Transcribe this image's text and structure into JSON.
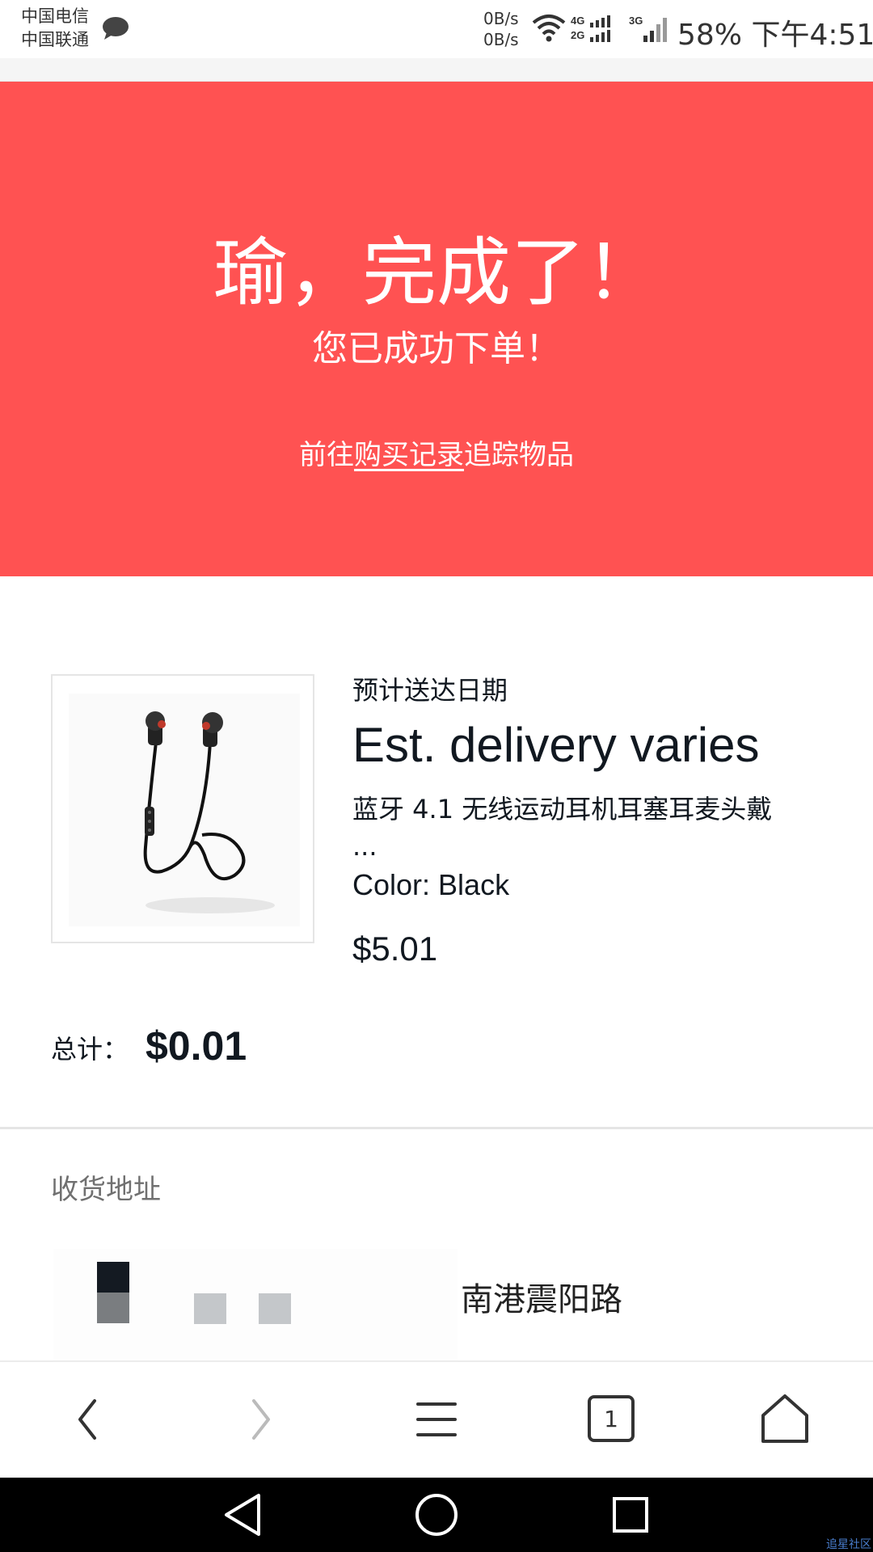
{
  "status_bar": {
    "carrier1": "中国电信",
    "carrier2": "中国联通",
    "speed_up": "0B/s",
    "speed_down": "0B/s",
    "net1_top": "4G",
    "net1_bottom": "2G",
    "net2": "3G",
    "battery": "58%",
    "time": "下午4:51"
  },
  "banner": {
    "title": "瑜，完成了！",
    "subtitle": "您已成功下单！",
    "track_prefix": "前往",
    "track_link": "购买记录",
    "track_suffix": "追踪物品",
    "background": "#ff5252"
  },
  "item": {
    "delivery_label": "预计送达日期",
    "delivery_value": "Est. delivery varies",
    "title_line1": "蓝牙 4.1 无线运动耳机耳塞耳麦头戴",
    "title_line2": "...",
    "color": "Color: Black",
    "price": "$5.01"
  },
  "total": {
    "label": "总计：",
    "value": "$0.01"
  },
  "shipping": {
    "label": "收货地址",
    "address_partial": "南港震阳路"
  },
  "toolbar": {
    "tab_count": "1"
  },
  "watermark": "追星社区"
}
